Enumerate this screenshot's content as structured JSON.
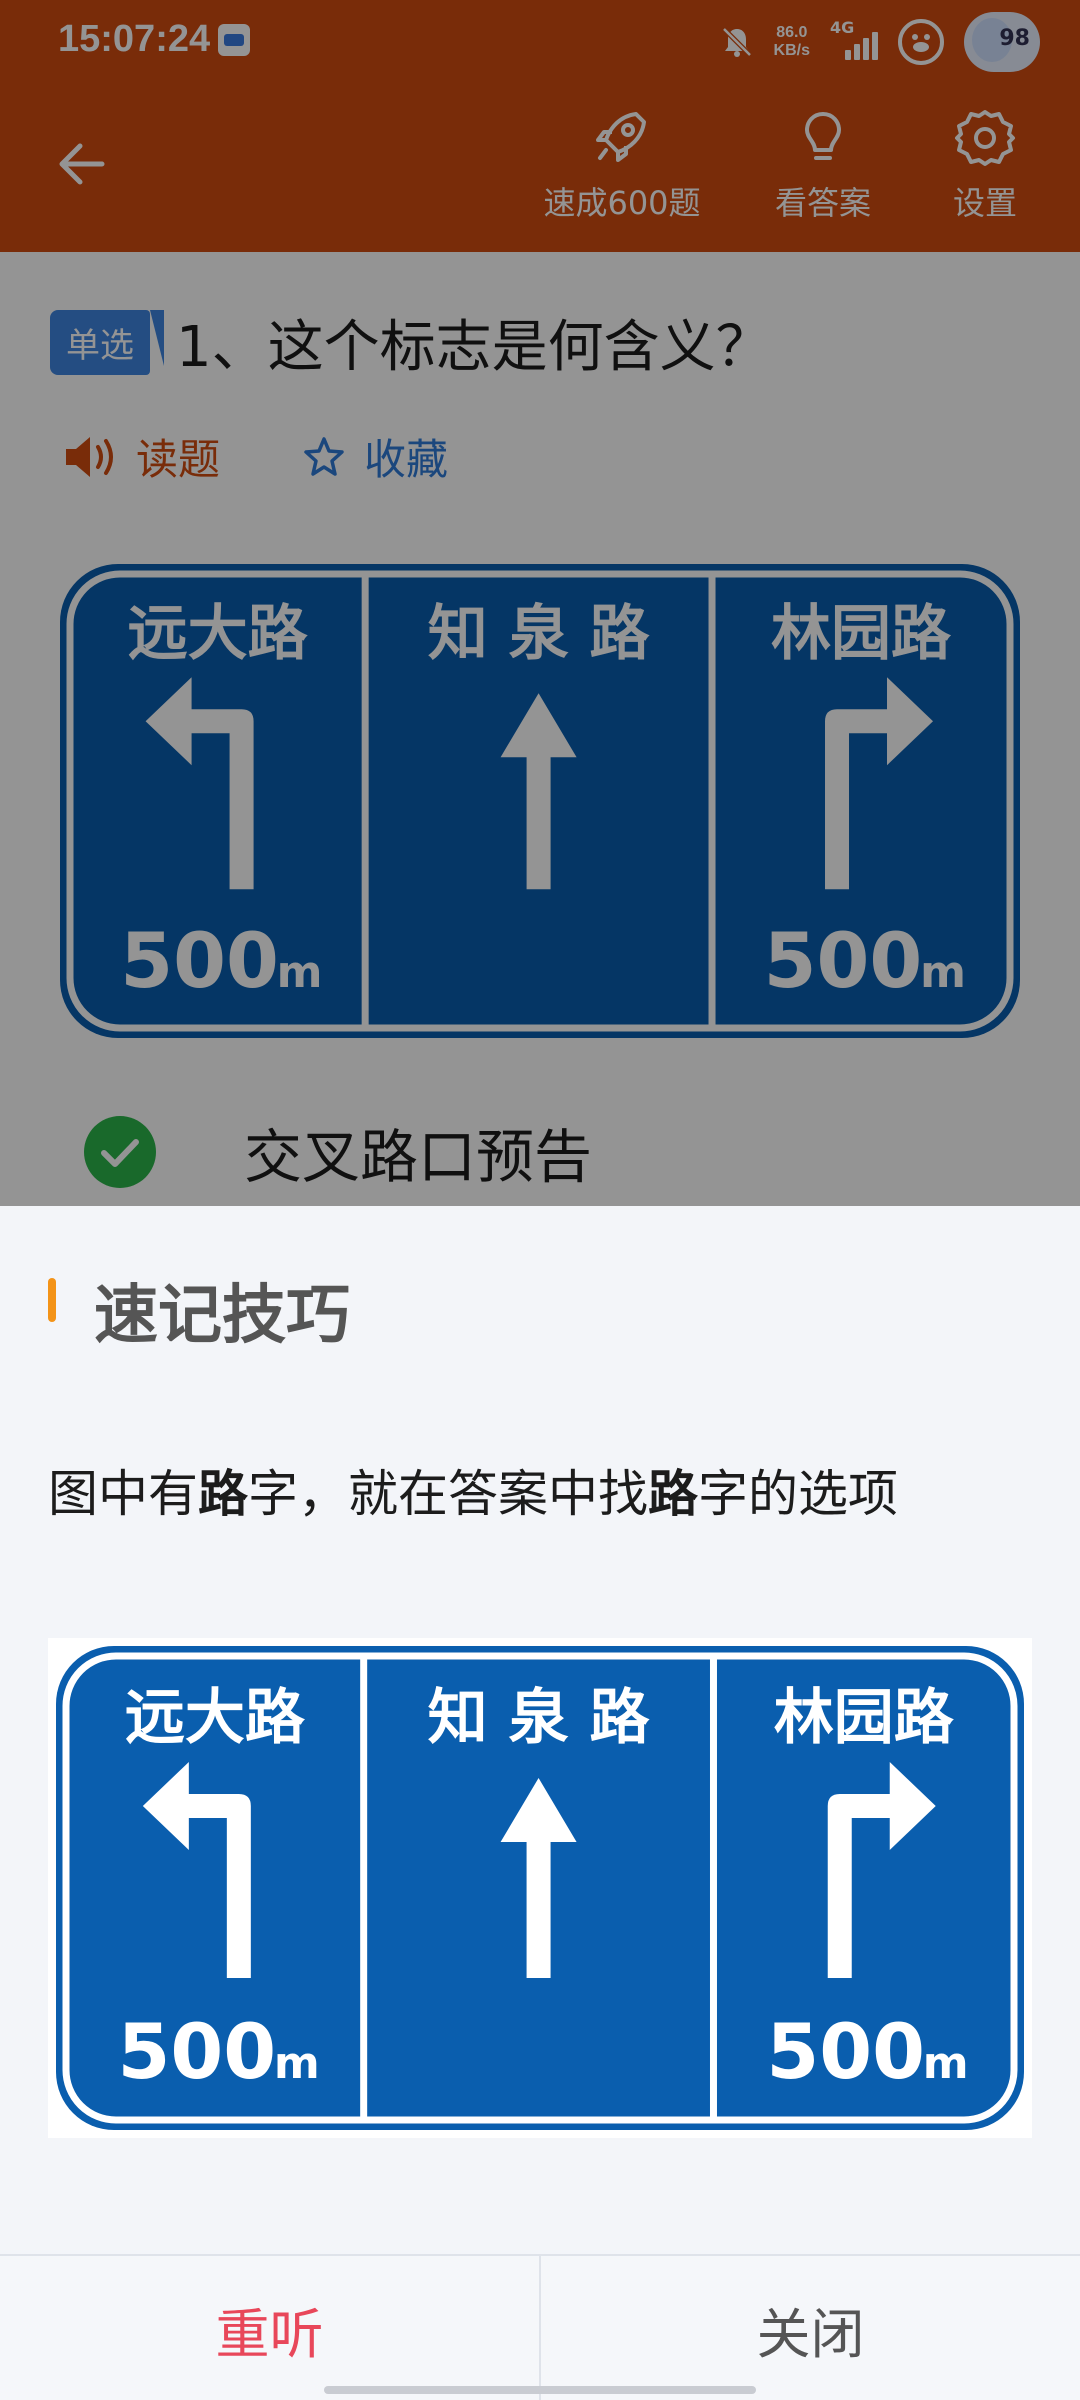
{
  "status": {
    "time": "15:07:24",
    "net_speed_value": "86.0",
    "net_speed_unit": "KB/s",
    "network": "4G",
    "avatar_text": "98"
  },
  "toolbar": {
    "speed_label": "速成600题",
    "answer_label": "看答案",
    "settings_label": "设置"
  },
  "question": {
    "type_badge": "单选",
    "text": "1、这个标志是何含义？",
    "read_label": "读题",
    "favorite_label": "收藏"
  },
  "sign": {
    "panels": [
      {
        "name": "远大路",
        "distance": "500",
        "unit": "m"
      },
      {
        "name": "知 泉 路"
      },
      {
        "name": "林园路",
        "distance": "500",
        "unit": "m"
      }
    ]
  },
  "option": {
    "text": "交叉路口预告"
  },
  "sheet": {
    "title": "速记技巧",
    "tip_parts": [
      "图中有",
      "路",
      "字，就在答案中找",
      "路",
      "字的选项"
    ],
    "replay_label": "重听",
    "close_label": "关闭"
  },
  "colors": {
    "brand": "#d14c10",
    "sign_blue": "#0a5eae",
    "accent_red": "#e8475a",
    "title_bar": "#f39318",
    "check_green": "#2bb54a"
  }
}
